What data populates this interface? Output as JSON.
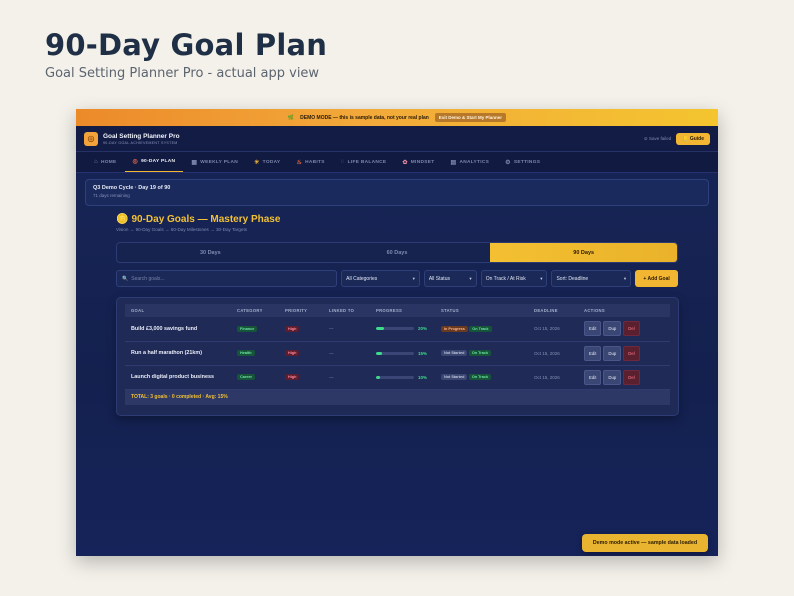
{
  "page": {
    "title": "90-Day Goal Plan",
    "subtitle": "Goal Setting Planner Pro - actual app view"
  },
  "banner": {
    "icon": "leaf-icon",
    "text": "DEMO MODE — this is sample data, not your real plan",
    "exit_label": "Exit Demo & Start My Planner"
  },
  "header": {
    "brand_name": "Goal Setting Planner Pro",
    "brand_tagline": "90-DAY GOAL ACHIEVEMENT SYSTEM",
    "save_status": "Save failed",
    "guide_label": "Guide"
  },
  "nav": {
    "items": [
      {
        "label": "HOME",
        "icon": "home-icon"
      },
      {
        "label": "90-DAY PLAN",
        "icon": "target-icon",
        "active": true
      },
      {
        "label": "WEEKLY PLAN",
        "icon": "calendar-icon"
      },
      {
        "label": "TODAY",
        "icon": "sun-icon"
      },
      {
        "label": "HABITS",
        "icon": "flame-icon"
      },
      {
        "label": "LIFE BALANCE",
        "icon": "circle-icon"
      },
      {
        "label": "MINDSET",
        "icon": "brain-icon"
      },
      {
        "label": "ANALYTICS",
        "icon": "chart-icon"
      },
      {
        "label": "SETTINGS",
        "icon": "gear-icon"
      }
    ]
  },
  "cycle": {
    "title": "Q3 Demo Cycle · Day 19 of 90",
    "remaining": "71 days remaining"
  },
  "section": {
    "title": "90-Day Goals — Mastery Phase",
    "breadcrumb": "Vision → 90-Day Goals → 60-Day Milestones → 30-Day Targets"
  },
  "tabs": [
    {
      "label": "30 Days",
      "active": false
    },
    {
      "label": "60 Days",
      "active": false
    },
    {
      "label": "90 Days",
      "active": true
    }
  ],
  "filters": {
    "search_placeholder": "Search goals...",
    "category": "All Categories",
    "status": "All Status",
    "track": "On Track / At Risk",
    "sort": "Sort: Deadline",
    "add_label": "+ Add Goal"
  },
  "table": {
    "columns": [
      "GOAL",
      "CATEGORY",
      "PRIORITY",
      "LINKED TO",
      "PROGRESS",
      "STATUS",
      "DEADLINE",
      "ACTIONS"
    ],
    "rows": [
      {
        "goal": "Build £3,000 savings fund",
        "category": "Finance",
        "priority": "High",
        "linked": "—",
        "progress": 20,
        "progress_label": "20%",
        "status": "In Progress",
        "track": "On Track",
        "deadline": "Oct 15, 2026"
      },
      {
        "goal": "Run a half marathon (21km)",
        "category": "Health",
        "priority": "High",
        "linked": "—",
        "progress": 15,
        "progress_label": "15%",
        "status": "Not Started",
        "track": "On Track",
        "deadline": "Oct 15, 2026"
      },
      {
        "goal": "Launch digital product business",
        "category": "Career",
        "priority": "High",
        "linked": "—",
        "progress": 10,
        "progress_label": "10%",
        "status": "Not Started",
        "track": "On Track",
        "deadline": "Oct 15, 2026"
      }
    ],
    "actions": {
      "edit": "Edit",
      "dup": "Dup",
      "del": "Del"
    },
    "total": "TOTAL: 3 goals · 0 completed · Avg: 15%"
  },
  "toast": "Demo mode active — sample data loaded",
  "colors": {
    "accent": "#f2b632",
    "app_bg": "#172557",
    "success": "#3ddc8a",
    "danger": "#ff8b9c"
  }
}
